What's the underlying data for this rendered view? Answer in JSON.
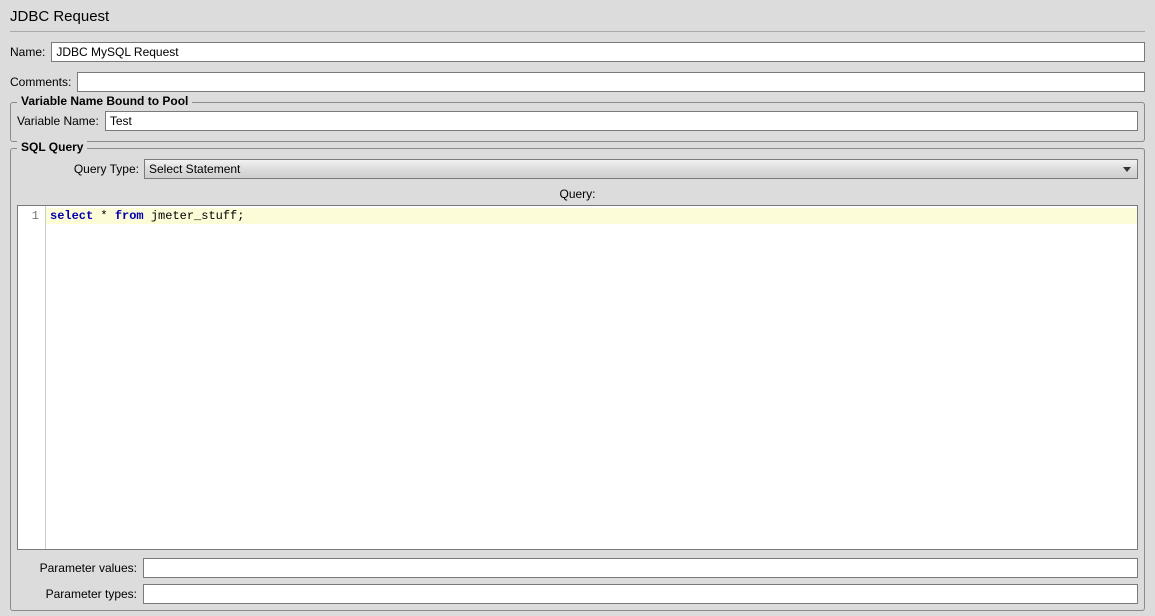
{
  "title": "JDBC Request",
  "labels": {
    "name": "Name:",
    "comments": "Comments:",
    "variableNameSection": "Variable Name Bound to Pool",
    "variableName": "Variable Name:",
    "sqlQuerySection": "SQL Query",
    "queryType": "Query Type:",
    "query": "Query:",
    "parameterValues": "Parameter values:",
    "parameterTypes": "Parameter types:"
  },
  "values": {
    "name": "JDBC MySQL Request",
    "comments": "",
    "variableName": "Test",
    "queryType": "Select Statement",
    "parameterValues": "",
    "parameterTypes": ""
  },
  "sql": {
    "lineNumber": "1",
    "kw_select": "select",
    "star": " * ",
    "kw_from": "from",
    "space": " ",
    "table": "jmeter_stuff",
    "semicolon": ";"
  }
}
